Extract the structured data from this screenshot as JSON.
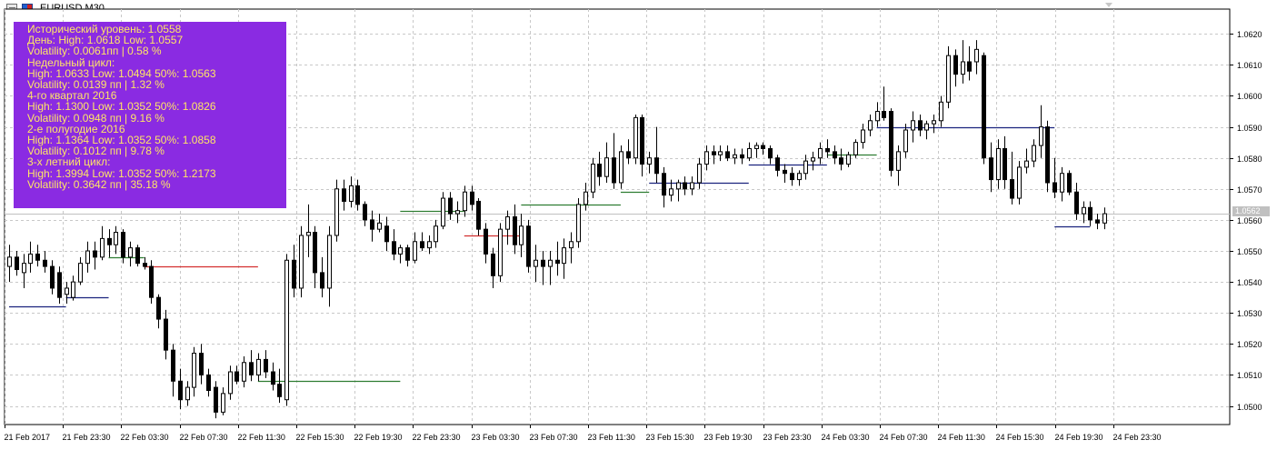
{
  "window": {
    "title": "EURUSD,M30",
    "close_hint": "chart-options-icon"
  },
  "info_panel": {
    "background": "#8a2be2",
    "text_color": "#ffe566",
    "lines": [
      "Исторический уровень: 1.0558",
      "День: High: 1.0618 Low: 1.0557",
      "Volatility: 0.0061пп | 0.58 %",
      "Недельный цикл:",
      "High: 1.0633 Low: 1.0494 50%: 1.0563",
      "Volatility: 0.0139 пп | 1.32 %",
      "4-го квартал 2016",
      "High: 1.1300 Low: 1.0352 50%: 1.0826",
      "Volatility: 0.0948 пп | 9.16 %",
      "2-е полугодие 2016",
      "High: 1.1364 Low: 1.0352 50%: 1.0858",
      "Volatility: 0.1012 пп | 9.78 %",
      "3-х летний цикл:",
      "High: 1.3994 Low: 1.0352 50%: 1.2173",
      "Volatility: 0.3642 пп | 35.18 %"
    ]
  },
  "current_price": {
    "value": 1.0562,
    "label": "1.0562",
    "line_color": "#c0c0c0"
  },
  "chart_data": {
    "type": "candlestick",
    "symbol": "EURUSD",
    "timeframe": "M30",
    "grid": true,
    "ylim": [
      1.0494,
      1.0628
    ],
    "y_ticks": [
      "1.0620",
      "1.0610",
      "1.0600",
      "1.0590",
      "1.0580",
      "1.0570",
      "1.0560",
      "1.0550",
      "1.0540",
      "1.0530",
      "1.0520",
      "1.0510",
      "1.0500"
    ],
    "x_ticks": [
      "21 Feb 2017",
      "21 Feb 23:30",
      "22 Feb 03:30",
      "22 Feb 07:30",
      "22 Feb 11:30",
      "22 Feb 15:30",
      "22 Feb 19:30",
      "22 Feb 23:30",
      "23 Feb 03:30",
      "23 Feb 07:30",
      "23 Feb 11:30",
      "23 Feb 15:30",
      "23 Feb 19:30",
      "23 Feb 23:30",
      "24 Feb 03:30",
      "24 Feb 07:30",
      "24 Feb 11:30",
      "24 Feb 15:30",
      "24 Feb 19:30",
      "24 Feb 23:30"
    ],
    "colors": {
      "bull_body": "#ffffff",
      "bear_body": "#000000",
      "outline": "#000000",
      "grid": "#c8c8c8",
      "text": "#000000"
    },
    "candles": [
      {
        "o": 1.0545,
        "h": 1.0552,
        "l": 1.054,
        "c": 1.0548
      },
      {
        "o": 1.0548,
        "h": 1.055,
        "l": 1.0542,
        "c": 1.0544
      },
      {
        "o": 1.0543,
        "h": 1.0549,
        "l": 1.0538,
        "c": 1.0546
      },
      {
        "o": 1.0546,
        "h": 1.0553,
        "l": 1.0543,
        "c": 1.0549
      },
      {
        "o": 1.0549,
        "h": 1.0552,
        "l": 1.0545,
        "c": 1.0547
      },
      {
        "o": 1.0547,
        "h": 1.055,
        "l": 1.0543,
        "c": 1.0545
      },
      {
        "o": 1.0545,
        "h": 1.0547,
        "l": 1.0536,
        "c": 1.0538
      },
      {
        "o": 1.0543,
        "h": 1.0545,
        "l": 1.0533,
        "c": 1.0535
      },
      {
        "o": 1.0536,
        "h": 1.054,
        "l": 1.0533,
        "c": 1.0538
      },
      {
        "o": 1.0535,
        "h": 1.0542,
        "l": 1.0534,
        "c": 1.054
      },
      {
        "o": 1.054,
        "h": 1.0548,
        "l": 1.0539,
        "c": 1.0546
      },
      {
        "o": 1.0546,
        "h": 1.0553,
        "l": 1.0543,
        "c": 1.055
      },
      {
        "o": 1.055,
        "h": 1.0553,
        "l": 1.0544,
        "c": 1.0548
      },
      {
        "o": 1.0548,
        "h": 1.0558,
        "l": 1.0547,
        "c": 1.0554
      },
      {
        "o": 1.0554,
        "h": 1.0557,
        "l": 1.0548,
        "c": 1.0552
      },
      {
        "o": 1.0552,
        "h": 1.0558,
        "l": 1.0549,
        "c": 1.0556
      },
      {
        "o": 1.0556,
        "h": 1.0557,
        "l": 1.0546,
        "c": 1.0548
      },
      {
        "o": 1.0548,
        "h": 1.0553,
        "l": 1.0545,
        "c": 1.0551
      },
      {
        "o": 1.0551,
        "h": 1.0552,
        "l": 1.0545,
        "c": 1.0546
      },
      {
        "o": 1.0546,
        "h": 1.0548,
        "l": 1.0544,
        "c": 1.0545
      },
      {
        "o": 1.0545,
        "h": 1.0547,
        "l": 1.0533,
        "c": 1.0535
      },
      {
        "o": 1.0535,
        "h": 1.0536,
        "l": 1.0525,
        "c": 1.0528
      },
      {
        "o": 1.0528,
        "h": 1.0531,
        "l": 1.0515,
        "c": 1.0518
      },
      {
        "o": 1.0518,
        "h": 1.052,
        "l": 1.0503,
        "c": 1.0508
      },
      {
        "o": 1.0508,
        "h": 1.0512,
        "l": 1.0499,
        "c": 1.0502
      },
      {
        "o": 1.0502,
        "h": 1.0508,
        "l": 1.05,
        "c": 1.0506
      },
      {
        "o": 1.0506,
        "h": 1.0519,
        "l": 1.0503,
        "c": 1.0517
      },
      {
        "o": 1.0517,
        "h": 1.052,
        "l": 1.0507,
        "c": 1.051
      },
      {
        "o": 1.051,
        "h": 1.0512,
        "l": 1.0503,
        "c": 1.0505
      },
      {
        "o": 1.0506,
        "h": 1.0508,
        "l": 1.0496,
        "c": 1.0498
      },
      {
        "o": 1.0498,
        "h": 1.0506,
        "l": 1.0497,
        "c": 1.0504
      },
      {
        "o": 1.0504,
        "h": 1.0513,
        "l": 1.0502,
        "c": 1.0511
      },
      {
        "o": 1.0511,
        "h": 1.0513,
        "l": 1.0507,
        "c": 1.0508
      },
      {
        "o": 1.0508,
        "h": 1.0516,
        "l": 1.0506,
        "c": 1.0514
      },
      {
        "o": 1.0514,
        "h": 1.0518,
        "l": 1.0508,
        "c": 1.051
      },
      {
        "o": 1.051,
        "h": 1.0517,
        "l": 1.0508,
        "c": 1.0515
      },
      {
        "o": 1.0515,
        "h": 1.0518,
        "l": 1.0509,
        "c": 1.0511
      },
      {
        "o": 1.0511,
        "h": 1.0514,
        "l": 1.0505,
        "c": 1.0507
      },
      {
        "o": 1.0507,
        "h": 1.0512,
        "l": 1.0501,
        "c": 1.0503
      },
      {
        "o": 1.0502,
        "h": 1.0549,
        "l": 1.05,
        "c": 1.0547
      },
      {
        "o": 1.0547,
        "h": 1.0552,
        "l": 1.0535,
        "c": 1.0538
      },
      {
        "o": 1.0538,
        "h": 1.0558,
        "l": 1.0535,
        "c": 1.0555
      },
      {
        "o": 1.0555,
        "h": 1.0565,
        "l": 1.0548,
        "c": 1.0556
      },
      {
        "o": 1.0556,
        "h": 1.0558,
        "l": 1.0538,
        "c": 1.0543
      },
      {
        "o": 1.0543,
        "h": 1.0548,
        "l": 1.0535,
        "c": 1.0538
      },
      {
        "o": 1.0538,
        "h": 1.0558,
        "l": 1.0532,
        "c": 1.0555
      },
      {
        "o": 1.0555,
        "h": 1.0573,
        "l": 1.0553,
        "c": 1.057
      },
      {
        "o": 1.057,
        "h": 1.0573,
        "l": 1.0563,
        "c": 1.0566
      },
      {
        "o": 1.0566,
        "h": 1.0574,
        "l": 1.0564,
        "c": 1.0571
      },
      {
        "o": 1.0571,
        "h": 1.0573,
        "l": 1.0563,
        "c": 1.0565
      },
      {
        "o": 1.0565,
        "h": 1.0566,
        "l": 1.0558,
        "c": 1.056
      },
      {
        "o": 1.056,
        "h": 1.0563,
        "l": 1.0553,
        "c": 1.0557
      },
      {
        "o": 1.0557,
        "h": 1.0562,
        "l": 1.0556,
        "c": 1.0559
      },
      {
        "o": 1.0558,
        "h": 1.0561,
        "l": 1.055,
        "c": 1.0553
      },
      {
        "o": 1.0553,
        "h": 1.0557,
        "l": 1.0547,
        "c": 1.0549
      },
      {
        "o": 1.0549,
        "h": 1.0552,
        "l": 1.0546,
        "c": 1.0551
      },
      {
        "o": 1.0551,
        "h": 1.0552,
        "l": 1.0545,
        "c": 1.0547
      },
      {
        "o": 1.0547,
        "h": 1.0556,
        "l": 1.0546,
        "c": 1.0553
      },
      {
        "o": 1.0553,
        "h": 1.0556,
        "l": 1.055,
        "c": 1.0551
      },
      {
        "o": 1.0551,
        "h": 1.0555,
        "l": 1.0549,
        "c": 1.0553
      },
      {
        "o": 1.0553,
        "h": 1.056,
        "l": 1.0551,
        "c": 1.0558
      },
      {
        "o": 1.0558,
        "h": 1.0569,
        "l": 1.0557,
        "c": 1.0567
      },
      {
        "o": 1.0567,
        "h": 1.0569,
        "l": 1.056,
        "c": 1.0562
      },
      {
        "o": 1.0562,
        "h": 1.0566,
        "l": 1.0559,
        "c": 1.0563
      },
      {
        "o": 1.0563,
        "h": 1.0571,
        "l": 1.0561,
        "c": 1.0569
      },
      {
        "o": 1.0569,
        "h": 1.0571,
        "l": 1.0563,
        "c": 1.0565
      },
      {
        "o": 1.0566,
        "h": 1.0567,
        "l": 1.0555,
        "c": 1.0557
      },
      {
        "o": 1.0557,
        "h": 1.0559,
        "l": 1.0546,
        "c": 1.0549
      },
      {
        "o": 1.0549,
        "h": 1.0551,
        "l": 1.0538,
        "c": 1.0542
      },
      {
        "o": 1.0542,
        "h": 1.0559,
        "l": 1.054,
        "c": 1.0557
      },
      {
        "o": 1.0557,
        "h": 1.0563,
        "l": 1.0552,
        "c": 1.0561
      },
      {
        "o": 1.0561,
        "h": 1.0565,
        "l": 1.0549,
        "c": 1.0552
      },
      {
        "o": 1.0552,
        "h": 1.0562,
        "l": 1.0548,
        "c": 1.0558
      },
      {
        "o": 1.0558,
        "h": 1.056,
        "l": 1.0543,
        "c": 1.0545
      },
      {
        "o": 1.0545,
        "h": 1.0552,
        "l": 1.054,
        "c": 1.0547
      },
      {
        "o": 1.0547,
        "h": 1.055,
        "l": 1.0539,
        "c": 1.0545
      },
      {
        "o": 1.0545,
        "h": 1.055,
        "l": 1.0539,
        "c": 1.0547
      },
      {
        "o": 1.0547,
        "h": 1.0553,
        "l": 1.0542,
        "c": 1.0546
      },
      {
        "o": 1.0546,
        "h": 1.0554,
        "l": 1.0541,
        "c": 1.0551
      },
      {
        "o": 1.0551,
        "h": 1.0556,
        "l": 1.0546,
        "c": 1.0553
      },
      {
        "o": 1.0553,
        "h": 1.0567,
        "l": 1.0551,
        "c": 1.0565
      },
      {
        "o": 1.0565,
        "h": 1.0572,
        "l": 1.0563,
        "c": 1.0569
      },
      {
        "o": 1.0569,
        "h": 1.058,
        "l": 1.0567,
        "c": 1.0578
      },
      {
        "o": 1.0578,
        "h": 1.0582,
        "l": 1.0571,
        "c": 1.0574
      },
      {
        "o": 1.0574,
        "h": 1.0585,
        "l": 1.0572,
        "c": 1.058
      },
      {
        "o": 1.058,
        "h": 1.0588,
        "l": 1.057,
        "c": 1.0572
      },
      {
        "o": 1.0572,
        "h": 1.0584,
        "l": 1.057,
        "c": 1.0582
      },
      {
        "o": 1.0582,
        "h": 1.0586,
        "l": 1.0578,
        "c": 1.058
      },
      {
        "o": 1.058,
        "h": 1.0594,
        "l": 1.0578,
        "c": 1.0593
      },
      {
        "o": 1.0593,
        "h": 1.0594,
        "l": 1.0574,
        "c": 1.0578
      },
      {
        "o": 1.0578,
        "h": 1.0582,
        "l": 1.0575,
        "c": 1.058
      },
      {
        "o": 1.058,
        "h": 1.059,
        "l": 1.0572,
        "c": 1.0575
      },
      {
        "o": 1.0575,
        "h": 1.0577,
        "l": 1.0564,
        "c": 1.0568
      },
      {
        "o": 1.0568,
        "h": 1.0573,
        "l": 1.0566,
        "c": 1.057
      },
      {
        "o": 1.057,
        "h": 1.0573,
        "l": 1.0566,
        "c": 1.0572
      },
      {
        "o": 1.0572,
        "h": 1.0574,
        "l": 1.0568,
        "c": 1.057
      },
      {
        "o": 1.057,
        "h": 1.0574,
        "l": 1.0568,
        "c": 1.0572
      },
      {
        "o": 1.0572,
        "h": 1.058,
        "l": 1.057,
        "c": 1.0578
      },
      {
        "o": 1.0578,
        "h": 1.0584,
        "l": 1.0576,
        "c": 1.0582
      },
      {
        "o": 1.0582,
        "h": 1.0584,
        "l": 1.0578,
        "c": 1.0581
      },
      {
        "o": 1.0581,
        "h": 1.0584,
        "l": 1.0579,
        "c": 1.0582
      },
      {
        "o": 1.0582,
        "h": 1.0584,
        "l": 1.0579,
        "c": 1.058
      },
      {
        "o": 1.058,
        "h": 1.0583,
        "l": 1.0578,
        "c": 1.0581
      },
      {
        "o": 1.0581,
        "h": 1.0583,
        "l": 1.0578,
        "c": 1.058
      },
      {
        "o": 1.058,
        "h": 1.0585,
        "l": 1.0579,
        "c": 1.0583
      },
      {
        "o": 1.0583,
        "h": 1.0585,
        "l": 1.058,
        "c": 1.0584
      },
      {
        "o": 1.0584,
        "h": 1.0585,
        "l": 1.0581,
        "c": 1.0583
      },
      {
        "o": 1.0583,
        "h": 1.0584,
        "l": 1.0578,
        "c": 1.058
      },
      {
        "o": 1.058,
        "h": 1.0581,
        "l": 1.0574,
        "c": 1.0576
      },
      {
        "o": 1.0576,
        "h": 1.0578,
        "l": 1.0572,
        "c": 1.0575
      },
      {
        "o": 1.0575,
        "h": 1.0577,
        "l": 1.0571,
        "c": 1.0573
      },
      {
        "o": 1.0573,
        "h": 1.0576,
        "l": 1.0571,
        "c": 1.0575
      },
      {
        "o": 1.0575,
        "h": 1.0581,
        "l": 1.0573,
        "c": 1.0579
      },
      {
        "o": 1.0579,
        "h": 1.0582,
        "l": 1.0576,
        "c": 1.058
      },
      {
        "o": 1.058,
        "h": 1.0585,
        "l": 1.0578,
        "c": 1.0583
      },
      {
        "o": 1.0583,
        "h": 1.0586,
        "l": 1.058,
        "c": 1.0582
      },
      {
        "o": 1.0582,
        "h": 1.0584,
        "l": 1.0578,
        "c": 1.058
      },
      {
        "o": 1.058,
        "h": 1.0583,
        "l": 1.0576,
        "c": 1.0578
      },
      {
        "o": 1.0578,
        "h": 1.0582,
        "l": 1.0577,
        "c": 1.0581
      },
      {
        "o": 1.0581,
        "h": 1.0586,
        "l": 1.058,
        "c": 1.0585
      },
      {
        "o": 1.0585,
        "h": 1.0591,
        "l": 1.0583,
        "c": 1.0589
      },
      {
        "o": 1.0589,
        "h": 1.0594,
        "l": 1.0587,
        "c": 1.0592
      },
      {
        "o": 1.0592,
        "h": 1.0598,
        "l": 1.059,
        "c": 1.0595
      },
      {
        "o": 1.0595,
        "h": 1.0603,
        "l": 1.0592,
        "c": 1.0593
      },
      {
        "o": 1.0595,
        "h": 1.0596,
        "l": 1.0574,
        "c": 1.0576
      },
      {
        "o": 1.0576,
        "h": 1.0584,
        "l": 1.0571,
        "c": 1.0582
      },
      {
        "o": 1.0582,
        "h": 1.0591,
        "l": 1.058,
        "c": 1.0589
      },
      {
        "o": 1.0589,
        "h": 1.0595,
        "l": 1.0585,
        "c": 1.0592
      },
      {
        "o": 1.0592,
        "h": 1.0594,
        "l": 1.0587,
        "c": 1.0589
      },
      {
        "o": 1.0589,
        "h": 1.0592,
        "l": 1.0586,
        "c": 1.0591
      },
      {
        "o": 1.0591,
        "h": 1.0594,
        "l": 1.0588,
        "c": 1.0592
      },
      {
        "o": 1.0592,
        "h": 1.06,
        "l": 1.059,
        "c": 1.0598
      },
      {
        "o": 1.0598,
        "h": 1.0616,
        "l": 1.0596,
        "c": 1.0613
      },
      {
        "o": 1.0613,
        "h": 1.0615,
        "l": 1.0603,
        "c": 1.0607
      },
      {
        "o": 1.0607,
        "h": 1.0618,
        "l": 1.0604,
        "c": 1.0611
      },
      {
        "o": 1.0611,
        "h": 1.0616,
        "l": 1.0605,
        "c": 1.0608
      },
      {
        "o": 1.0611,
        "h": 1.0618,
        "l": 1.0607,
        "c": 1.0615
      },
      {
        "o": 1.0613,
        "h": 1.0614,
        "l": 1.0578,
        "c": 1.058
      },
      {
        "o": 1.058,
        "h": 1.0585,
        "l": 1.0569,
        "c": 1.0573
      },
      {
        "o": 1.0573,
        "h": 1.0586,
        "l": 1.057,
        "c": 1.0583
      },
      {
        "o": 1.0583,
        "h": 1.0587,
        "l": 1.057,
        "c": 1.0573
      },
      {
        "o": 1.0573,
        "h": 1.0582,
        "l": 1.0565,
        "c": 1.0567
      },
      {
        "o": 1.0567,
        "h": 1.0579,
        "l": 1.0565,
        "c": 1.0577
      },
      {
        "o": 1.0577,
        "h": 1.0583,
        "l": 1.0575,
        "c": 1.0579
      },
      {
        "o": 1.0579,
        "h": 1.0586,
        "l": 1.0577,
        "c": 1.0584
      },
      {
        "o": 1.0584,
        "h": 1.0597,
        "l": 1.058,
        "c": 1.059
      },
      {
        "o": 1.059,
        "h": 1.0592,
        "l": 1.0569,
        "c": 1.0572
      },
      {
        "o": 1.0572,
        "h": 1.058,
        "l": 1.0567,
        "c": 1.0569
      },
      {
        "o": 1.0569,
        "h": 1.0577,
        "l": 1.0566,
        "c": 1.0575
      },
      {
        "o": 1.0575,
        "h": 1.0576,
        "l": 1.0568,
        "c": 1.0569
      },
      {
        "o": 1.0569,
        "h": 1.0572,
        "l": 1.056,
        "c": 1.0562
      },
      {
        "o": 1.0562,
        "h": 1.0566,
        "l": 1.0559,
        "c": 1.0564
      },
      {
        "o": 1.0564,
        "h": 1.0566,
        "l": 1.0558,
        "c": 1.056
      },
      {
        "o": 1.056,
        "h": 1.0562,
        "l": 1.0557,
        "c": 1.0559
      },
      {
        "o": 1.0559,
        "h": 1.0564,
        "l": 1.0557,
        "c": 1.0562
      }
    ],
    "levels": [
      {
        "price": 1.0532,
        "from": 0,
        "to": 8,
        "color": "#1a237e"
      },
      {
        "price": 1.0535,
        "from": 8,
        "to": 14,
        "color": "#1a237e"
      },
      {
        "price": 1.0548,
        "from": 14,
        "to": 19,
        "color": "#2e7d32"
      },
      {
        "price": 1.0545,
        "from": 19,
        "to": 35,
        "color": "#d32f2f"
      },
      {
        "price": 1.0508,
        "from": 35,
        "to": 55,
        "color": "#2e7d32"
      },
      {
        "price": 1.0563,
        "from": 55,
        "to": 64,
        "color": "#2e7d32"
      },
      {
        "price": 1.0555,
        "from": 64,
        "to": 72,
        "color": "#d32f2f"
      },
      {
        "price": 1.0565,
        "from": 72,
        "to": 86,
        "color": "#2e7d32"
      },
      {
        "price": 1.0569,
        "from": 86,
        "to": 90,
        "color": "#2e7d32"
      },
      {
        "price": 1.0572,
        "from": 90,
        "to": 104,
        "color": "#1a237e"
      },
      {
        "price": 1.0578,
        "from": 104,
        "to": 115,
        "color": "#1a237e"
      },
      {
        "price": 1.0581,
        "from": 115,
        "to": 122,
        "color": "#2e7d32"
      },
      {
        "price": 1.059,
        "from": 122,
        "to": 147,
        "color": "#1a237e"
      },
      {
        "price": 1.0558,
        "from": 147,
        "to": 152,
        "color": "#1a237e"
      }
    ]
  }
}
